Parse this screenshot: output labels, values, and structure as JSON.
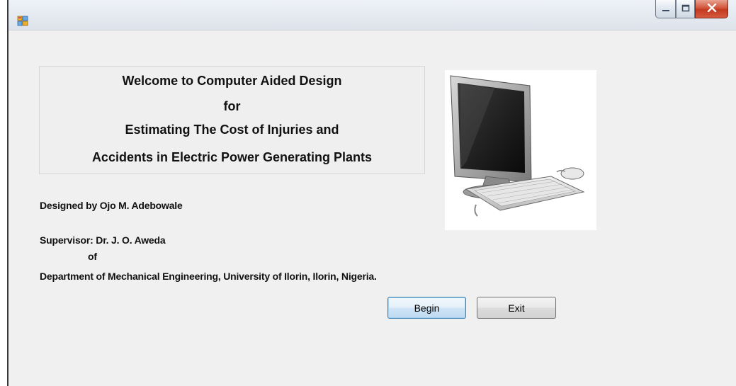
{
  "window": {
    "title": "",
    "icon": "app-window-icon",
    "controls": {
      "minimize": "minimize-icon",
      "maximize": "maximize-icon",
      "close": "close-icon"
    }
  },
  "welcome": {
    "line1": "Welcome to Computer  Aided Design",
    "line2": "for",
    "line3": "Estimating The Cost of Injuries and",
    "line4": "Accidents in Electric Power Generating Plants"
  },
  "image": {
    "icon": "desktop-computer-image"
  },
  "credits": {
    "designed_by": "Designed by Ojo M. Adebowale",
    "supervisor": "Supervisor: Dr. J. O. Aweda",
    "of": "of",
    "department": "Department of Mechanical Engineering, University of  Ilorin, Ilorin, Nigeria."
  },
  "buttons": {
    "begin": "Begin",
    "exit": "Exit"
  },
  "colors": {
    "close_red": "#c23a1f",
    "focus_blue": "#3c7fb1",
    "form_bg": "#f0f0f0"
  }
}
